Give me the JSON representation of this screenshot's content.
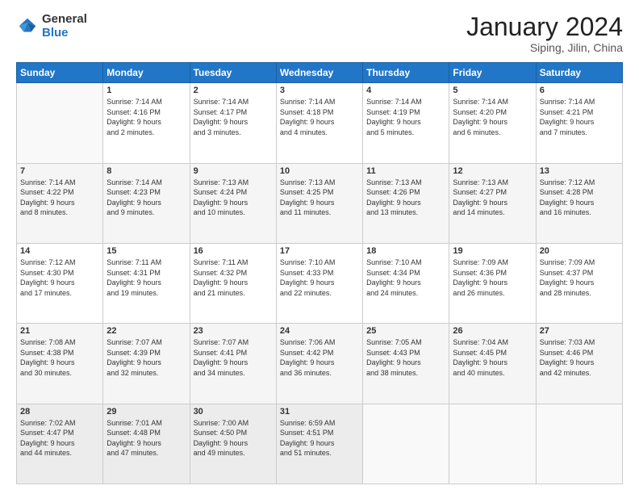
{
  "logo": {
    "general": "General",
    "blue": "Blue"
  },
  "header": {
    "title": "January 2024",
    "subtitle": "Siping, Jilin, China"
  },
  "days_of_week": [
    "Sunday",
    "Monday",
    "Tuesday",
    "Wednesday",
    "Thursday",
    "Friday",
    "Saturday"
  ],
  "weeks": [
    [
      {
        "day": "",
        "info": ""
      },
      {
        "day": "1",
        "info": "Sunrise: 7:14 AM\nSunset: 4:16 PM\nDaylight: 9 hours\nand 2 minutes."
      },
      {
        "day": "2",
        "info": "Sunrise: 7:14 AM\nSunset: 4:17 PM\nDaylight: 9 hours\nand 3 minutes."
      },
      {
        "day": "3",
        "info": "Sunrise: 7:14 AM\nSunset: 4:18 PM\nDaylight: 9 hours\nand 4 minutes."
      },
      {
        "day": "4",
        "info": "Sunrise: 7:14 AM\nSunset: 4:19 PM\nDaylight: 9 hours\nand 5 minutes."
      },
      {
        "day": "5",
        "info": "Sunrise: 7:14 AM\nSunset: 4:20 PM\nDaylight: 9 hours\nand 6 minutes."
      },
      {
        "day": "6",
        "info": "Sunrise: 7:14 AM\nSunset: 4:21 PM\nDaylight: 9 hours\nand 7 minutes."
      }
    ],
    [
      {
        "day": "7",
        "info": "Sunrise: 7:14 AM\nSunset: 4:22 PM\nDaylight: 9 hours\nand 8 minutes."
      },
      {
        "day": "8",
        "info": "Sunrise: 7:14 AM\nSunset: 4:23 PM\nDaylight: 9 hours\nand 9 minutes."
      },
      {
        "day": "9",
        "info": "Sunrise: 7:13 AM\nSunset: 4:24 PM\nDaylight: 9 hours\nand 10 minutes."
      },
      {
        "day": "10",
        "info": "Sunrise: 7:13 AM\nSunset: 4:25 PM\nDaylight: 9 hours\nand 11 minutes."
      },
      {
        "day": "11",
        "info": "Sunrise: 7:13 AM\nSunset: 4:26 PM\nDaylight: 9 hours\nand 13 minutes."
      },
      {
        "day": "12",
        "info": "Sunrise: 7:13 AM\nSunset: 4:27 PM\nDaylight: 9 hours\nand 14 minutes."
      },
      {
        "day": "13",
        "info": "Sunrise: 7:12 AM\nSunset: 4:28 PM\nDaylight: 9 hours\nand 16 minutes."
      }
    ],
    [
      {
        "day": "14",
        "info": "Sunrise: 7:12 AM\nSunset: 4:30 PM\nDaylight: 9 hours\nand 17 minutes."
      },
      {
        "day": "15",
        "info": "Sunrise: 7:11 AM\nSunset: 4:31 PM\nDaylight: 9 hours\nand 19 minutes."
      },
      {
        "day": "16",
        "info": "Sunrise: 7:11 AM\nSunset: 4:32 PM\nDaylight: 9 hours\nand 21 minutes."
      },
      {
        "day": "17",
        "info": "Sunrise: 7:10 AM\nSunset: 4:33 PM\nDaylight: 9 hours\nand 22 minutes."
      },
      {
        "day": "18",
        "info": "Sunrise: 7:10 AM\nSunset: 4:34 PM\nDaylight: 9 hours\nand 24 minutes."
      },
      {
        "day": "19",
        "info": "Sunrise: 7:09 AM\nSunset: 4:36 PM\nDaylight: 9 hours\nand 26 minutes."
      },
      {
        "day": "20",
        "info": "Sunrise: 7:09 AM\nSunset: 4:37 PM\nDaylight: 9 hours\nand 28 minutes."
      }
    ],
    [
      {
        "day": "21",
        "info": "Sunrise: 7:08 AM\nSunset: 4:38 PM\nDaylight: 9 hours\nand 30 minutes."
      },
      {
        "day": "22",
        "info": "Sunrise: 7:07 AM\nSunset: 4:39 PM\nDaylight: 9 hours\nand 32 minutes."
      },
      {
        "day": "23",
        "info": "Sunrise: 7:07 AM\nSunset: 4:41 PM\nDaylight: 9 hours\nand 34 minutes."
      },
      {
        "day": "24",
        "info": "Sunrise: 7:06 AM\nSunset: 4:42 PM\nDaylight: 9 hours\nand 36 minutes."
      },
      {
        "day": "25",
        "info": "Sunrise: 7:05 AM\nSunset: 4:43 PM\nDaylight: 9 hours\nand 38 minutes."
      },
      {
        "day": "26",
        "info": "Sunrise: 7:04 AM\nSunset: 4:45 PM\nDaylight: 9 hours\nand 40 minutes."
      },
      {
        "day": "27",
        "info": "Sunrise: 7:03 AM\nSunset: 4:46 PM\nDaylight: 9 hours\nand 42 minutes."
      }
    ],
    [
      {
        "day": "28",
        "info": "Sunrise: 7:02 AM\nSunset: 4:47 PM\nDaylight: 9 hours\nand 44 minutes."
      },
      {
        "day": "29",
        "info": "Sunrise: 7:01 AM\nSunset: 4:48 PM\nDaylight: 9 hours\nand 47 minutes."
      },
      {
        "day": "30",
        "info": "Sunrise: 7:00 AM\nSunset: 4:50 PM\nDaylight: 9 hours\nand 49 minutes."
      },
      {
        "day": "31",
        "info": "Sunrise: 6:59 AM\nSunset: 4:51 PM\nDaylight: 9 hours\nand 51 minutes."
      },
      {
        "day": "",
        "info": ""
      },
      {
        "day": "",
        "info": ""
      },
      {
        "day": "",
        "info": ""
      }
    ]
  ]
}
